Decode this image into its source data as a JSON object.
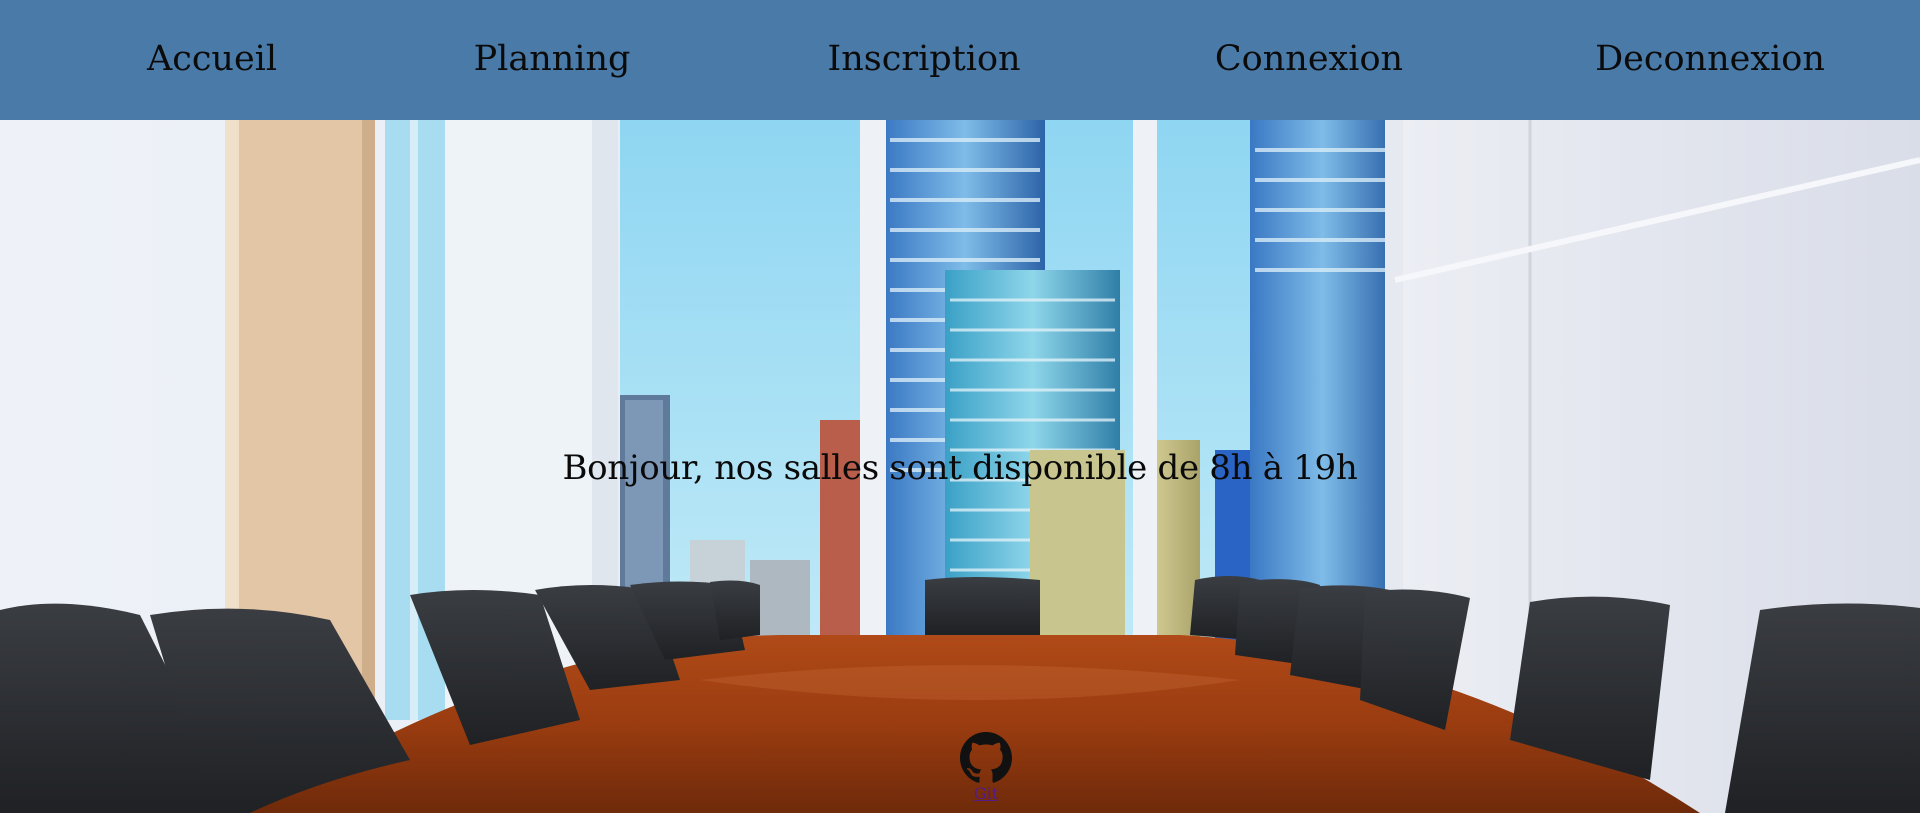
{
  "nav": {
    "items": [
      {
        "label": "Accueil"
      },
      {
        "label": "Planning"
      },
      {
        "label": "Inscription"
      },
      {
        "label": "Connexion"
      },
      {
        "label": "Deconnexion"
      }
    ],
    "background_color": "#4a7aa8"
  },
  "hero": {
    "message": "Bonjour, nos salles sont disponible de 8h à 19h",
    "image_subject": "conference-room-with-city-view"
  },
  "footer": {
    "git_icon": "github-icon",
    "git_label": "Git"
  }
}
